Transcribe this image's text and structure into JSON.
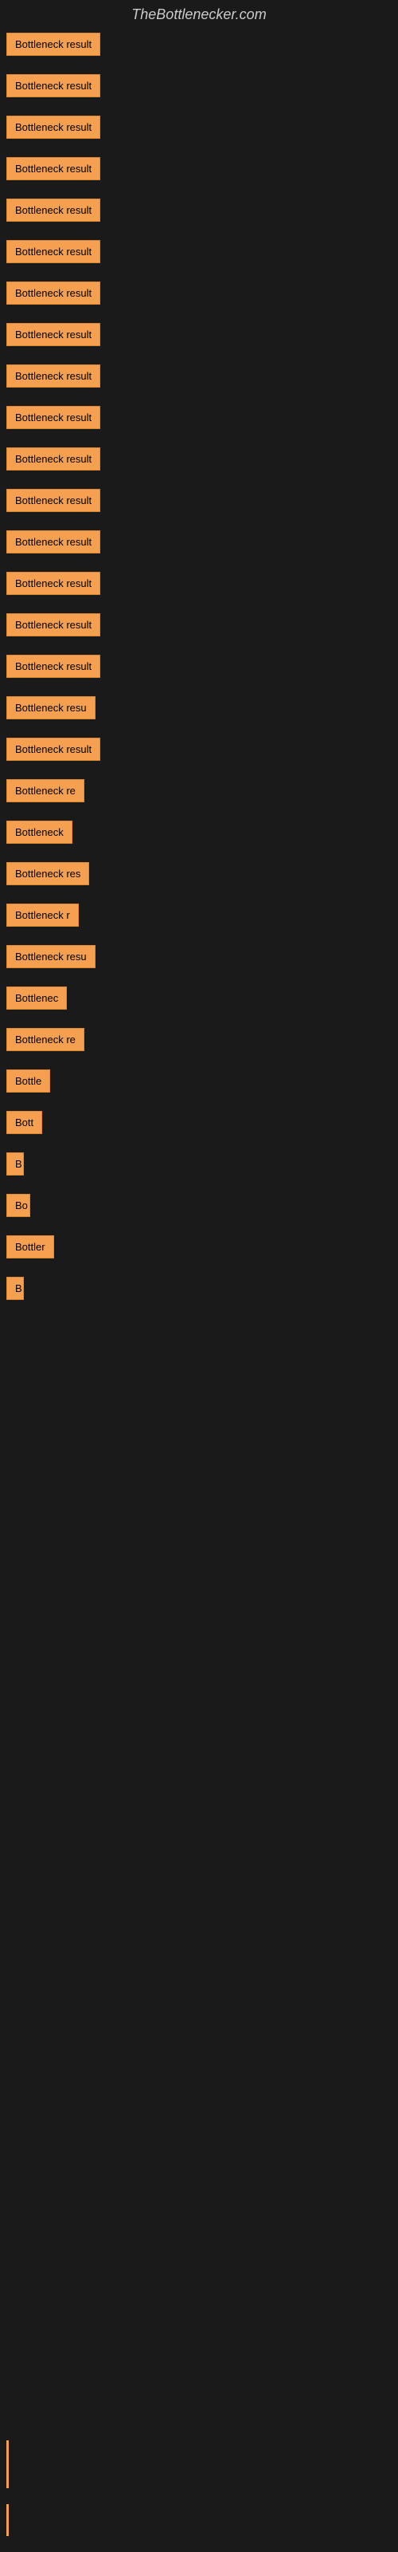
{
  "site": {
    "title": "TheBottlenecker.com"
  },
  "items": [
    {
      "label": "Bottleneck result",
      "width": 155
    },
    {
      "label": "Bottleneck result",
      "width": 155
    },
    {
      "label": "Bottleneck result",
      "width": 155
    },
    {
      "label": "Bottleneck result",
      "width": 155
    },
    {
      "label": "Bottleneck result",
      "width": 155
    },
    {
      "label": "Bottleneck result",
      "width": 155
    },
    {
      "label": "Bottleneck result",
      "width": 155
    },
    {
      "label": "Bottleneck result",
      "width": 155
    },
    {
      "label": "Bottleneck result",
      "width": 155
    },
    {
      "label": "Bottleneck result",
      "width": 155
    },
    {
      "label": "Bottleneck result",
      "width": 155
    },
    {
      "label": "Bottleneck result",
      "width": 155
    },
    {
      "label": "Bottleneck result",
      "width": 155
    },
    {
      "label": "Bottleneck result",
      "width": 155
    },
    {
      "label": "Bottleneck result",
      "width": 155
    },
    {
      "label": "Bottleneck result",
      "width": 155
    },
    {
      "label": "Bottleneck resu",
      "width": 130
    },
    {
      "label": "Bottleneck result",
      "width": 145
    },
    {
      "label": "Bottleneck re",
      "width": 118
    },
    {
      "label": "Bottleneck",
      "width": 90
    },
    {
      "label": "Bottleneck res",
      "width": 120
    },
    {
      "label": "Bottleneck r",
      "width": 100
    },
    {
      "label": "Bottleneck resu",
      "width": 128
    },
    {
      "label": "Bottlenec",
      "width": 85
    },
    {
      "label": "Bottleneck re",
      "width": 115
    },
    {
      "label": "Bottle",
      "width": 58
    },
    {
      "label": "Bott",
      "width": 45
    },
    {
      "label": "B",
      "width": 20
    },
    {
      "label": "Bo",
      "width": 30
    },
    {
      "label": "Bottler",
      "width": 60
    },
    {
      "label": "B",
      "width": 18
    }
  ]
}
